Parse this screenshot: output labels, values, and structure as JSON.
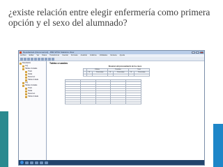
{
  "slide": {
    "title": "¿existe relación entre elegir enfermería como primera opción y el sexo del alumnado?"
  },
  "window": {
    "title": "Resultados1 [Documento1] - IBM SPSS Statistics Visor",
    "menu": [
      "Archivo",
      "Editar",
      "Ver",
      "Datos",
      "Transformar",
      "Insertar",
      "Formato",
      "Analizar",
      "Gráficos",
      "Utilidades",
      "Ventana",
      "Ayuda"
    ],
    "nav": [
      {
        "label": "Resultados",
        "level": 1
      },
      {
        "label": "Log",
        "level": 2
      },
      {
        "label": "Tablas cruzadas",
        "level": 2
      },
      {
        "label": "Título",
        "level": 3
      },
      {
        "label": "Notas",
        "level": 3
      },
      {
        "label": "Resumen",
        "level": 3
      },
      {
        "label": "Tabla cruzada",
        "level": 3
      },
      {
        "label": "Log",
        "level": 2
      },
      {
        "label": "Tablas cruzadas",
        "level": 2
      },
      {
        "label": "Título",
        "level": 3
      },
      {
        "label": "Notas",
        "level": 3
      },
      {
        "label": "Resumen",
        "level": 3
      },
      {
        "label": "Tabla cruzada",
        "level": 3
      }
    ],
    "section_heading": "Tablas cruzadas",
    "summary_table": {
      "caption": "Resumen del procesamiento de los casos",
      "group_headers": [
        "Válidos",
        "Perdidos",
        "Total"
      ],
      "sub_headers": [
        "N",
        "Porcentaje",
        "N",
        "Porcentaje",
        "N",
        "Porcentaje"
      ],
      "row_label": "",
      "values": [
        "",
        "",
        "",
        "",
        "",
        ""
      ]
    },
    "crosstab": {
      "caption": "",
      "column_headers": [
        "",
        "",
        "",
        "",
        ""
      ],
      "rows": [
        {
          "label": "",
          "sub": [
            "",
            "",
            ""
          ]
        },
        {
          "label": "",
          "sub": [
            "",
            "",
            ""
          ]
        },
        {
          "label": "",
          "sub": [
            "",
            "",
            ""
          ]
        },
        {
          "label": "",
          "sub": [
            "",
            "",
            ""
          ]
        },
        {
          "label": "",
          "sub": [
            "",
            "",
            ""
          ]
        },
        {
          "label": "",
          "sub": [
            "",
            "",
            ""
          ]
        },
        {
          "label": "",
          "sub": [
            "",
            "",
            ""
          ]
        },
        {
          "label": "",
          "sub": [
            "",
            "",
            ""
          ]
        },
        {
          "label": "",
          "sub": [
            "",
            "",
            ""
          ]
        },
        {
          "label": "",
          "sub": [
            "",
            "",
            ""
          ]
        }
      ]
    },
    "taskbar": {
      "clock": "",
      "apps": [
        "start",
        "explorer",
        "ie",
        "media",
        "spss",
        "word"
      ]
    }
  },
  "colors": {
    "title_text": "#404040",
    "deco_teal": "#2a8a8f",
    "deco_blue": "#1e86c8",
    "taskbar": "#22446c"
  }
}
